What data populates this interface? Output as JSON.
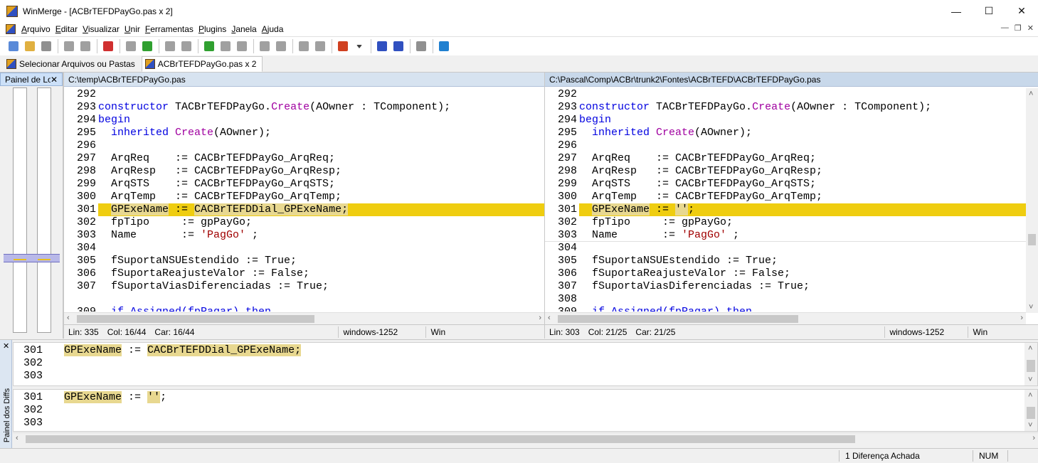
{
  "window": {
    "title": "WinMerge - [ACBrTEFDPayGo.pas x 2]",
    "minimize": "—",
    "maximize": "☐",
    "close": "✕"
  },
  "menu": {
    "items": [
      "Arquivo",
      "Editar",
      "Visualizar",
      "Unir",
      "Ferramentas",
      "Plugins",
      "Janela",
      "Ajuda"
    ],
    "mdi_minimize": "—",
    "mdi_restore": "❐",
    "mdi_close": "✕"
  },
  "toolbar": {
    "buttons": [
      {
        "name": "new-icon",
        "color": "#5a8ad8"
      },
      {
        "name": "open-icon",
        "color": "#e0b040"
      },
      {
        "name": "save-icon",
        "color": "#909090"
      },
      {
        "sep": true
      },
      {
        "name": "undo-icon",
        "color": "#a0a0a0"
      },
      {
        "name": "redo-icon",
        "color": "#a0a0a0"
      },
      {
        "sep": true
      },
      {
        "name": "merge-icon",
        "color": "#d03030"
      },
      {
        "sep": true
      },
      {
        "name": "next-diff-icon",
        "color": "#a0a0a0"
      },
      {
        "name": "prev-diff-icon",
        "color": "#30a030"
      },
      {
        "sep": true
      },
      {
        "name": "first-diff-icon",
        "color": "#a0a0a0"
      },
      {
        "name": "current-diff-icon",
        "color": "#a0a0a0"
      },
      {
        "sep": true
      },
      {
        "name": "last-diff-icon",
        "color": "#30a030"
      },
      {
        "name": "next-conflict-icon",
        "color": "#a0a0a0"
      },
      {
        "name": "prev-conflict-icon",
        "color": "#a0a0a0"
      },
      {
        "sep": true
      },
      {
        "name": "copy-right-icon",
        "color": "#a0a0a0"
      },
      {
        "name": "copy-left-icon",
        "color": "#a0a0a0"
      },
      {
        "sep": true
      },
      {
        "name": "copy-right-advance-icon",
        "color": "#a0a0a0"
      },
      {
        "name": "copy-left-advance-icon",
        "color": "#a0a0a0"
      },
      {
        "sep": true
      },
      {
        "name": "options-icon",
        "color": "#d04020"
      },
      {
        "name": "dropdown-icon",
        "color": "#404040"
      },
      {
        "sep": true
      },
      {
        "name": "all-right-icon",
        "color": "#3050c0"
      },
      {
        "name": "all-left-icon",
        "color": "#3050c0"
      },
      {
        "sep": true
      },
      {
        "name": "compare-icon",
        "color": "#909090"
      },
      {
        "sep": true
      },
      {
        "name": "refresh-icon",
        "color": "#2080d0"
      }
    ]
  },
  "tabs": [
    {
      "label": "Selecionar Arquivos ou Pastas",
      "active": false
    },
    {
      "label": "ACBrTEFDPayGo.pas x 2",
      "active": true
    }
  ],
  "location_pane": {
    "title": "Painel de Local",
    "close": "✕"
  },
  "left_pane": {
    "path": "C:\\temp\\ACBrTEFDPayGo.pas",
    "status": {
      "line": "Lin: 335",
      "col": "Col: 16/44",
      "car": "Car: 16/44",
      "encoding": "windows-1252",
      "eol": "Win"
    }
  },
  "right_pane": {
    "path": "C:\\Pascal\\Comp\\ACBr\\trunk2\\Fontes\\ACBrTEFD\\ACBrTEFDPayGo.pas",
    "status": {
      "line": "Lin: 303",
      "col": "Col: 21/25",
      "car": "Car: 21/25",
      "encoding": "windows-1252",
      "eol": "Win"
    }
  },
  "code": {
    "l292": "292",
    "l293": "293",
    "constructor": "constructor",
    "class_name": " TACBrTEFDPayGo.",
    "create": "Create",
    "params": "(AOwner : TComponent);",
    "l294": "294",
    "begin": "begin",
    "l295": "295",
    "inherited": "  inherited",
    "create2": " Create",
    "aowner": "(AOwner);",
    "l296": "296",
    "l297": "297",
    "arqreq": "  ArqReq    := CACBrTEFDPayGo_ArqReq;",
    "l298": "298",
    "arqresp": "  ArqResp   := CACBrTEFDPayGo_ArqResp;",
    "l299": "299",
    "arqsts": "  ArqSTS    := CACBrTEFDPayGo_ArqSTS;",
    "l300": "300",
    "arqtemp": "  ArqTemp   := CACBrTEFDPayGo_ArqTemp;",
    "l301": "301",
    "gpexe_name": "GPExeName",
    "assign": " := ",
    "gpexe_left_value": "CACBrTEFDDial_GPExeName;",
    "gpexe_right_value": "''",
    "semicolon": ";",
    "l302": "302",
    "fptipo": "  fpTipo     := gpPayGo;",
    "l303": "303",
    "name_assign": "  Name       := ",
    "paggo": "'PagGo'",
    "paggo_end": " ;",
    "l304": "304",
    "l305": "305",
    "nsu": "  fSuportaNSUEstendido := True;",
    "l306": "306",
    "reajuste": "  fSuportaReajusteValor := False;",
    "l307": "307",
    "vias": "  fSuportaViasDiferenciadas := True;",
    "l308": "308",
    "l309": "309",
    "if_assigned": "  if Assigned(fpPagar) then"
  },
  "diff_pane": {
    "label": "Painel dos Diffs",
    "close": "✕",
    "top_lines": [
      "301",
      "302",
      "303"
    ],
    "bottom_lines": [
      "301",
      "302",
      "303"
    ]
  },
  "statusbar": {
    "diff_count": "1 Diferença Achada",
    "num": "NUM"
  }
}
